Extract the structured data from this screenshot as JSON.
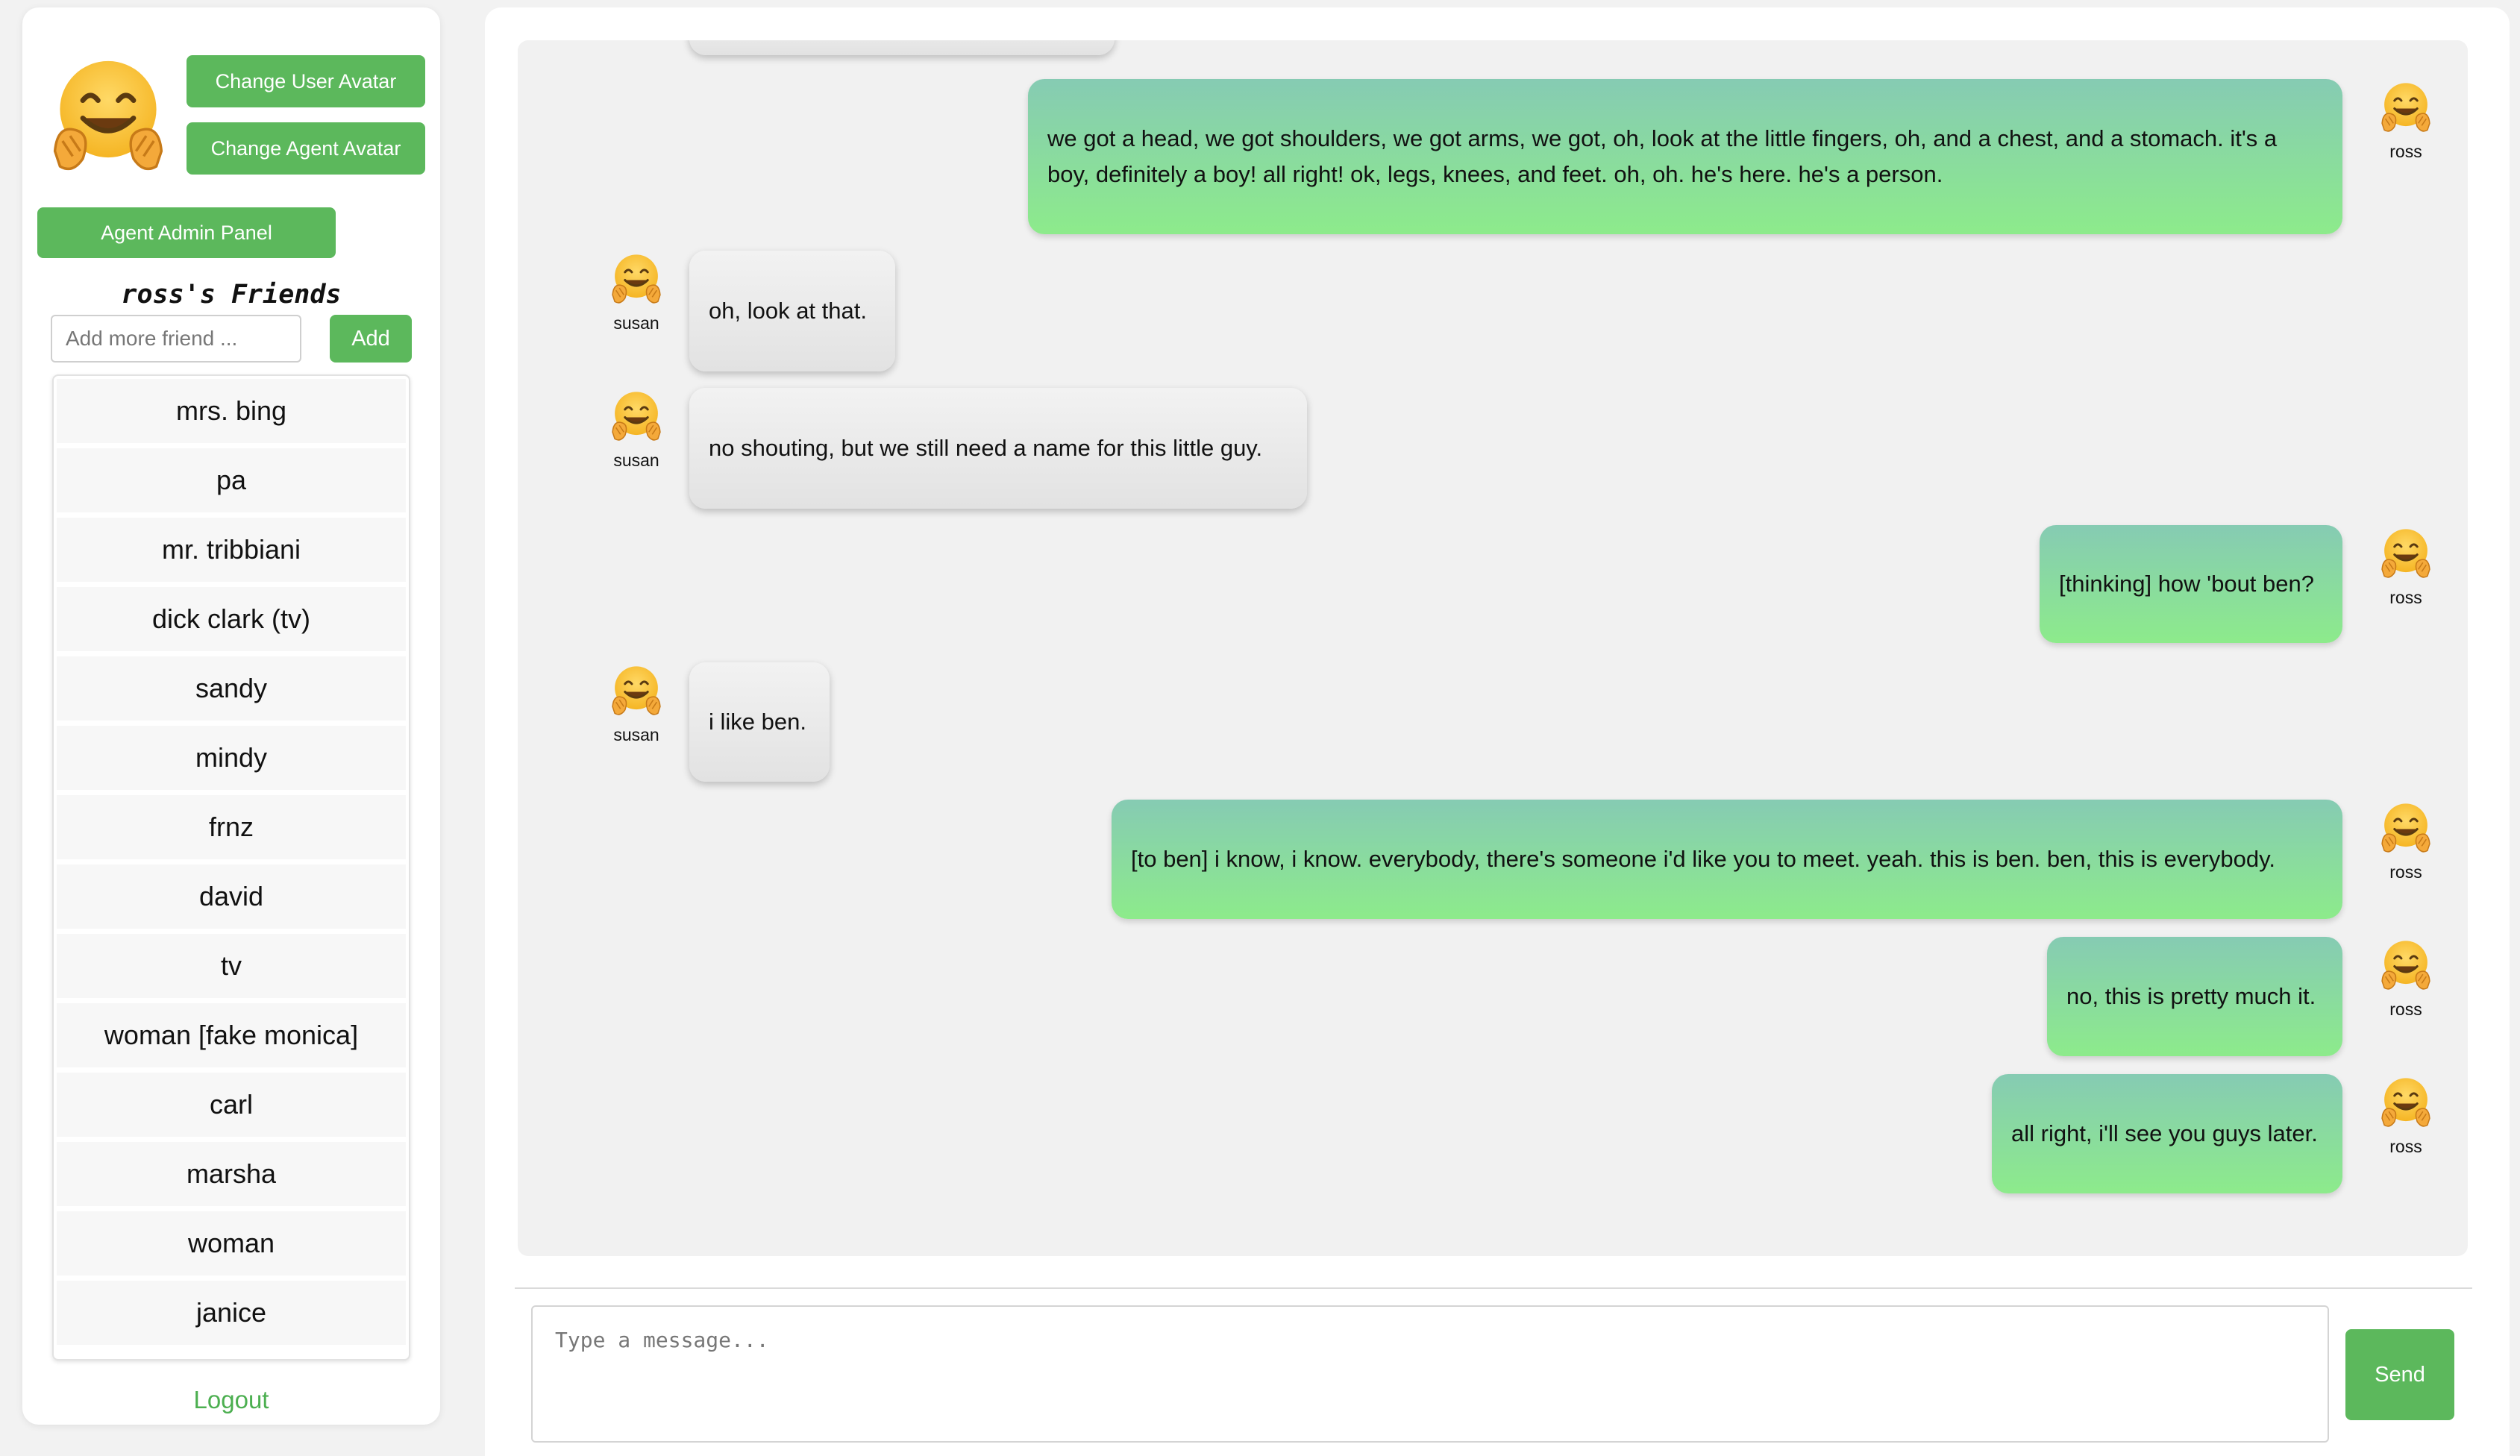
{
  "sidebar": {
    "change_user_avatar": "Change User Avatar",
    "change_agent_avatar": "Change Agent Avatar",
    "admin_panel": "Agent Admin Panel",
    "friends_title": "ross's Friends",
    "add_friend_placeholder": "Add more friend ...",
    "add_button": "Add",
    "friends": [
      "mrs. bing",
      "pa",
      "mr. tribbiani",
      "dick clark (tv)",
      "sandy",
      "mindy",
      "frnz",
      "david",
      "tv",
      "woman [fake monica]",
      "carl",
      "marsha",
      "woman",
      "janice"
    ],
    "logout": "Logout"
  },
  "chat": {
    "messages": [
      {
        "sender": "ross",
        "role": "user",
        "text": "we got a head, we got shoulders, we got arms, we got, oh, look at the little fingers, oh, and a chest, and a stomach. it's a boy, definitely a boy! all right! ok, legs, knees, and feet. oh, oh. he's here. he's a person."
      },
      {
        "sender": "susan",
        "role": "agent",
        "text": "oh, look at that."
      },
      {
        "sender": "susan",
        "role": "agent",
        "text": "no shouting, but we still need a name for this little guy."
      },
      {
        "sender": "ross",
        "role": "user",
        "text": "[thinking] how 'bout ben?"
      },
      {
        "sender": "susan",
        "role": "agent",
        "text": "i like ben."
      },
      {
        "sender": "ross",
        "role": "user",
        "text": "[to ben] i know, i know. everybody, there's someone i'd like you to meet. yeah. this is ben. ben, this is everybody."
      },
      {
        "sender": "ross",
        "role": "user",
        "text": "no, this is pretty much it."
      },
      {
        "sender": "ross",
        "role": "user",
        "text": "all right, i'll see you guys later."
      }
    ],
    "input_placeholder": "Type a message...",
    "send_button": "Send"
  },
  "icons": {
    "user_avatar": "hugging-face-icon",
    "agent_avatar": "hugging-face-icon"
  },
  "colors": {
    "accent_green": "#5cb85c",
    "logout_green": "#4caf50",
    "user_bubble_top": "#86cbb3",
    "user_bubble_bottom": "#8deb8b",
    "agent_bubble": "#e8e8e8"
  }
}
